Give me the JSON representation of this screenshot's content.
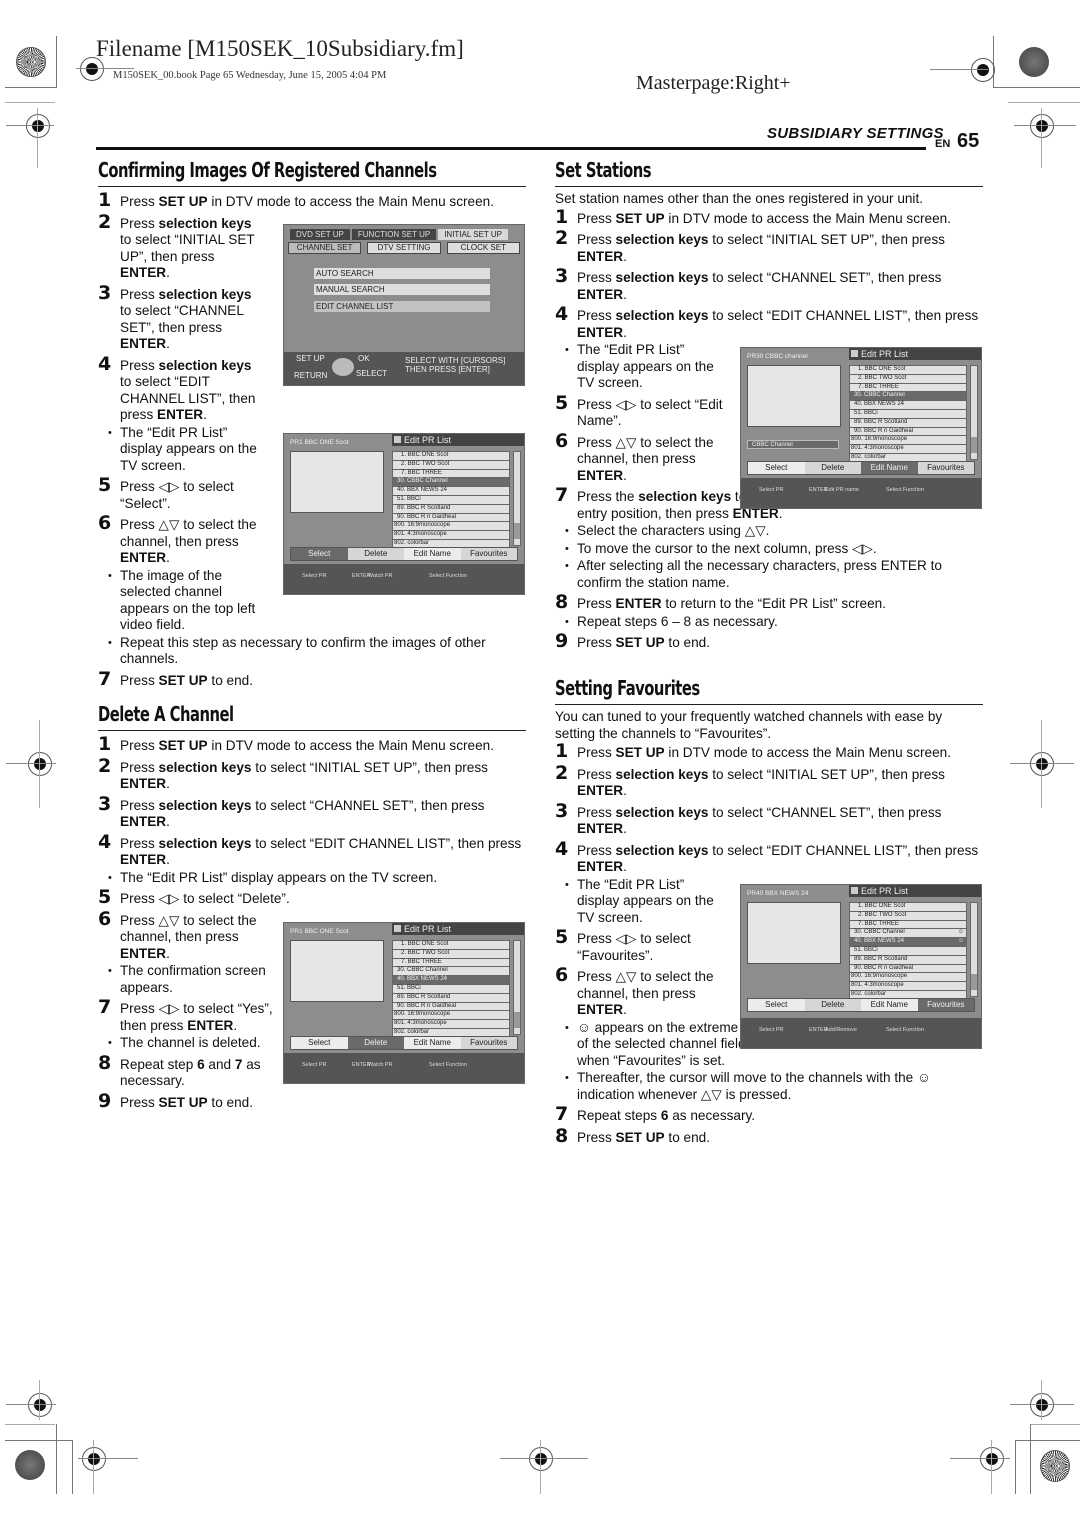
{
  "header": {
    "filename": "Filename [M150SEK_10Subsidiary.fm]",
    "book_line": "M150SEK_00.book  Page 65  Wednesday, June 15, 2005  4:04 PM",
    "masterpage": "Masterpage:Right+",
    "section": "SUBSIDIARY SETTINGS",
    "lang": "EN",
    "page_number": "65"
  },
  "sections": {
    "confirming": {
      "title": "Confirming Images Of Registered Channels",
      "steps": [
        {
          "n": "1",
          "pre": "Press ",
          "b": "SET UP",
          "post": " in DTV mode to access the Main Menu screen."
        },
        {
          "n": "2",
          "pre": "Press ",
          "b": "selection keys",
          "post": " to select “INITIAL SET UP”, then press ",
          "b2": "ENTER",
          "post2": "."
        },
        {
          "n": "3",
          "pre": "Press ",
          "b": "selection keys",
          "post": " to select “CHANNEL SET”, then press ",
          "b2": "ENTER",
          "post2": "."
        },
        {
          "n": "4",
          "pre": "Press ",
          "b": "selection keys",
          "post": " to select “EDIT CHANNEL LIST”, then press ",
          "b2": "ENTER",
          "post2": "."
        },
        {
          "n": "5",
          "pre": "Press ◁▷ to select “Select”."
        },
        {
          "n": "6",
          "pre": "Press △▽ to select the channel, then press ",
          "b": "ENTER",
          "post": "."
        },
        {
          "n": "7",
          "pre": "Press ",
          "b": "SET UP",
          "post": " to end."
        }
      ],
      "bullets": [
        "The “Edit PR List” display appears on the TV screen.",
        "The image of the selected channel appears on the top left video field.",
        "Repeat this step as necessary to confirm the images of other channels."
      ]
    },
    "delete": {
      "title": "Delete A Channel",
      "steps": [
        {
          "n": "1",
          "pre": "Press ",
          "b": "SET UP",
          "post": " in DTV mode to access the Main Menu screen."
        },
        {
          "n": "2",
          "pre": "Press ",
          "b": "selection keys",
          "post": " to select “INITIAL SET UP”, then press ",
          "b2": "ENTER",
          "post2": "."
        },
        {
          "n": "3",
          "pre": "Press ",
          "b": "selection keys",
          "post": " to select “CHANNEL SET”, then press ",
          "b2": "ENTER",
          "post2": "."
        },
        {
          "n": "4",
          "pre": "Press ",
          "b": "selection keys",
          "post": " to select “EDIT CHANNEL LIST”, then press ",
          "b2": "ENTER",
          "post2": "."
        },
        {
          "n": "5",
          "pre": "Press ◁▷ to select “Delete”."
        },
        {
          "n": "6",
          "pre": "Press △▽ to select the channel, then press ",
          "b": "ENTER",
          "post": "."
        },
        {
          "n": "7",
          "pre": "Press ◁▷ to select “Yes”, then press ",
          "b": "ENTER",
          "post": "."
        },
        {
          "n": "8",
          "pre": "Repeat step ",
          "b": "6",
          "post": " and ",
          "b2": "7",
          "post2": " as necessary."
        },
        {
          "n": "9",
          "pre": "Press ",
          "b": "SET UP",
          "post": " to end."
        }
      ],
      "bullets": [
        "The “Edit PR List” display appears on the TV screen.",
        "The confirmation screen appears.",
        "The channel is deleted."
      ]
    },
    "set_stations": {
      "title": "Set Stations",
      "intro": "Set station names other than the ones registered in your unit.",
      "steps": [
        {
          "n": "1",
          "pre": "Press ",
          "b": "SET UP",
          "post": " in DTV mode to access the Main Menu screen."
        },
        {
          "n": "2",
          "pre": "Press ",
          "b": "selection keys",
          "post": " to select “INITIAL SET UP”, then press ",
          "b2": "ENTER",
          "post2": "."
        },
        {
          "n": "3",
          "pre": "Press ",
          "b": "selection keys",
          "post": " to select “CHANNEL SET”, then press ",
          "b2": "ENTER",
          "post2": "."
        },
        {
          "n": "4",
          "pre": "Press ",
          "b": "selection keys",
          "post": " to select “EDIT CHANNEL LIST”, then press ",
          "b2": "ENTER",
          "post2": "."
        },
        {
          "n": "5",
          "pre": "Press ◁▷ to select “Edit Name”."
        },
        {
          "n": "6",
          "pre": "Press △▽ to select the channel, then press ",
          "b": "ENTER",
          "post": "."
        },
        {
          "n": "7",
          "pre": "Press the ",
          "b": "selection keys",
          "post": " to enter the characters at the character entry position, then press ",
          "b2": "ENTER",
          "post2": "."
        },
        {
          "n": "8",
          "pre": "Press ",
          "b": "ENTER",
          "post": " to return to the “Edit PR List” screen."
        },
        {
          "n": "9",
          "pre": "Press ",
          "b": "SET UP",
          "post": " to end."
        }
      ],
      "bullets": [
        "The “Edit PR List” display appears on the TV screen.",
        "Select the characters using △▽.",
        "To move the cursor to the next column, press ◁▷.",
        "After selecting all the necessary characters, press ENTER to confirm the station name.",
        "Repeat steps 6 – 8 as necessary."
      ]
    },
    "favourites": {
      "title": "Setting Favourites",
      "intro": "You can tuned to your frequently watched channels with ease by setting the channels to “Favourites”.",
      "steps": [
        {
          "n": "1",
          "pre": "Press ",
          "b": "SET UP",
          "post": " in DTV mode to access the Main Menu screen."
        },
        {
          "n": "2",
          "pre": "Press ",
          "b": "selection keys",
          "post": " to select “INITIAL SET UP”, then press ",
          "b2": "ENTER",
          "post2": "."
        },
        {
          "n": "3",
          "pre": "Press ",
          "b": "selection keys",
          "post": " to select “CHANNEL SET”, then press ",
          "b2": "ENTER",
          "post2": "."
        },
        {
          "n": "4",
          "pre": "Press ",
          "b": "selection keys",
          "post": " to select “EDIT CHANNEL LIST”, then press ",
          "b2": "ENTER",
          "post2": "."
        },
        {
          "n": "5",
          "pre": "Press ◁▷ to select “Favourites”."
        },
        {
          "n": "6",
          "pre": "Press △▽ to select the channel, then press ",
          "b": "ENTER",
          "post": "."
        },
        {
          "n": "7",
          "pre": "Repeat steps ",
          "b": "6",
          "post": " as necessary."
        },
        {
          "n": "8",
          "pre": "Press ",
          "b": "SET UP",
          "post": " to end."
        }
      ],
      "bullets": [
        "The “Edit PR List” display appears on the TV screen.",
        "☺ appears on the extreme right of the selected channel field when “Favourites” is set.",
        "Thereafter, the cursor will move to the channels with the ☺ indication whenever △▽ is pressed."
      ]
    }
  },
  "setup_menu": {
    "tabs": [
      "DVD SET UP",
      "FUNCTION SET UP",
      "INITIAL SET UP"
    ],
    "subtabs": [
      "CHANNEL SET",
      "DTV SETTING",
      "CLOCK SET"
    ],
    "items": [
      "AUTO SEARCH",
      "MANUAL SEARCH",
      "EDIT CHANNEL LIST"
    ],
    "footer": {
      "setup": "SET UP",
      "return": "RETURN",
      "ok": "OK",
      "select": "SELECT",
      "hint1": "SELECT WITH [CURSORS]",
      "hint2": "THEN PRESS [ENTER]"
    }
  },
  "pr_list": {
    "title": "Edit PR List",
    "channels": [
      "1. BBC ONE Scot",
      "2. BBC TWO Scot",
      "7. BBC THREE",
      "30. CBBC Channel",
      "40. BBX NEWS 24",
      "51. BBCi",
      "89. BBC R Scotland",
      "90. BBC R n Gaidheal",
      "800. 16:9monoscope",
      "801. 4:3monoscope",
      "802. colorbar"
    ],
    "buttons": [
      "Select",
      "Delete",
      "Edit Name",
      "Favourites"
    ],
    "screens": [
      {
        "header": "PR1 BBC ONE Scot",
        "footer": [
          "Select PR",
          "Watch PR",
          "Select Function"
        ]
      },
      {
        "header": "PR1 BBC ONE Scot",
        "footer": [
          "Select PR",
          "Watch PR",
          "Select Function"
        ]
      },
      {
        "header": "PR30 CBBC channel",
        "name_field": "CBBC Channel",
        "footer": [
          "Select PR",
          "Edit PR name",
          "Select Function"
        ]
      },
      {
        "header": "PR40 BBX NEWS 24",
        "footer": [
          "Select PR",
          "Add/Remove",
          "Select Function"
        ]
      }
    ],
    "enter_key": "ENTER",
    "fav_icon": "☺"
  }
}
